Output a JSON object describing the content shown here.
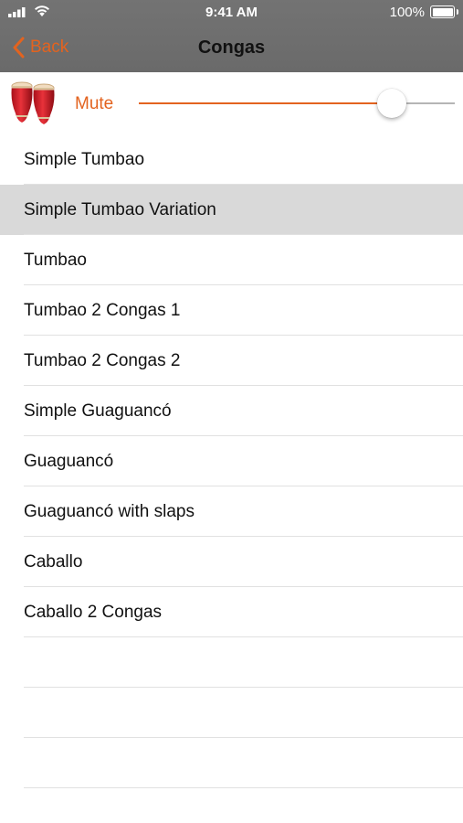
{
  "status_bar": {
    "time": "9:41 AM",
    "battery": "100%"
  },
  "nav": {
    "back_label": "Back",
    "title": "Congas"
  },
  "controls": {
    "mute_label": "Mute",
    "volume_level": 0.8,
    "accent_color": "#e3631f"
  },
  "list": {
    "selected_index": 1,
    "items": [
      {
        "label": "Simple Tumbao"
      },
      {
        "label": "Simple Tumbao Variation"
      },
      {
        "label": "Tumbao"
      },
      {
        "label": "Tumbao 2 Congas 1"
      },
      {
        "label": "Tumbao 2 Congas 2"
      },
      {
        "label": "Simple Guaguancó"
      },
      {
        "label": "Guaguancó"
      },
      {
        "label": "Guaguancó with slaps"
      },
      {
        "label": "Caballo"
      },
      {
        "label": "Caballo 2 Congas"
      }
    ]
  }
}
